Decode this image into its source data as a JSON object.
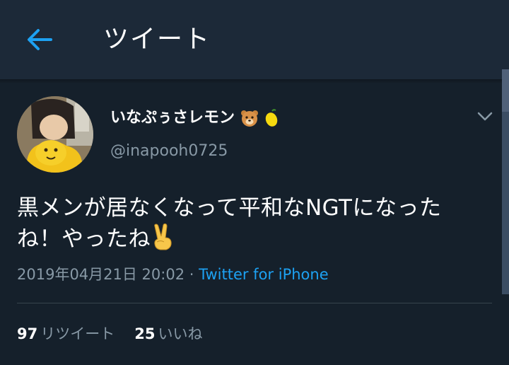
{
  "header": {
    "title": "ツイート",
    "back_icon": "back-arrow-icon"
  },
  "tweet": {
    "display_name": "いなぷぅさレモン",
    "name_emojis": [
      "bear-face-icon",
      "lemon-icon"
    ],
    "handle": "@inapooh0725",
    "text_line1": "黒メンが居なくなって平和なNGTになった",
    "text_line2": "ね！やったね",
    "text_emoji": "victory-hand-icon",
    "timestamp": "2019年04月21日 20:02",
    "separator": " · ",
    "source": "Twitter for iPhone"
  },
  "stats": {
    "retweets_count": "97",
    "retweets_label": "リツイート",
    "likes_count": "25",
    "likes_label": "いいね"
  },
  "colors": {
    "background": "#15202b",
    "header": "#1c2938",
    "accent": "#1da1f2",
    "secondary_text": "#8899a6"
  }
}
